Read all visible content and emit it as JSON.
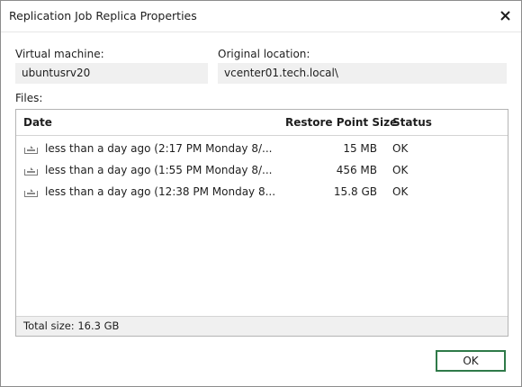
{
  "window": {
    "title": "Replication Job Replica Properties"
  },
  "fields": {
    "vm_label": "Virtual machine:",
    "vm_value": "ubuntusrv20",
    "location_label": "Original location:",
    "location_value": "vcenter01.tech.local\\"
  },
  "files": {
    "label": "Files:",
    "columns": {
      "date": "Date",
      "size": "Restore Point Size",
      "status": "Status"
    },
    "rows": [
      {
        "date": "less than a day ago (2:17 PM Monday 8/...",
        "size": "15 MB",
        "status": "OK"
      },
      {
        "date": "less than a day ago (1:55 PM Monday 8/...",
        "size": "456 MB",
        "status": "OK"
      },
      {
        "date": "less than a day ago (12:38 PM Monday 8...",
        "size": "15.8 GB",
        "status": "OK"
      }
    ],
    "total": "Total size: 16.3 GB"
  },
  "buttons": {
    "ok": "OK"
  },
  "colors": {
    "accent": "#2f7a49",
    "field_bg": "#f0f0f0",
    "border": "#b4b4b4"
  },
  "icons": {
    "close": "close-icon",
    "restore_point": "restore-point-icon"
  }
}
